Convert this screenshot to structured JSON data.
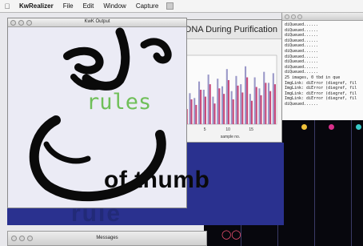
{
  "menubar": {
    "app_name": "KwRealizer",
    "items": [
      "File",
      "Edit",
      "Window",
      "Capture"
    ]
  },
  "output_window": {
    "title": "KwK Output"
  },
  "chart_window": {
    "title": "...of DNA During Purification"
  },
  "chart_data": {
    "type": "bar",
    "title": "...of DNA During Purification",
    "xlabel": "sample no.",
    "ylabel": "",
    "x_ticks": [
      "5",
      "10",
      "15"
    ],
    "series": [
      {
        "values": [
          30,
          45,
          38,
          62,
          50,
          72,
          40,
          66,
          55,
          80,
          48,
          70,
          58,
          84,
          44,
          68,
          52,
          76,
          60,
          74
        ]
      },
      {
        "values": [
          22,
          36,
          28,
          50,
          40,
          58,
          30,
          52,
          44,
          64,
          36,
          56,
          46,
          68,
          34,
          54,
          42,
          60,
          48,
          58
        ]
      }
    ],
    "ylim": [
      0,
      100
    ],
    "colors": [
      "#9a98c8",
      "#c8487a"
    ]
  },
  "console": {
    "lines": [
      "diQueued......",
      "diQueued......",
      "diQueued......",
      "diQueued......",
      "diQueued......",
      "diQueued......",
      "diQueued......",
      "diQueued......",
      "diQueued......",
      "diQueued......",
      "25 images, 0 tbd in que",
      "ImgLink: diError (diegref, fil",
      "ImgLink: diError (diegref, fil",
      "ImgLink: diError (diegref, fil",
      "ImgLink: diError (diegref, fil",
      "diQueued......"
    ]
  },
  "overlay": {
    "rules_text": "rules",
    "thumb_text": "of thumb"
  },
  "messages_window": {
    "title": "Messages"
  },
  "dots": [
    "#f0c23a",
    "#d8308a",
    "#38c8c8"
  ],
  "colors": {
    "band_blue": "#2a318f",
    "rules_green": "#6fbf58",
    "dark_panel": "#07070d"
  }
}
